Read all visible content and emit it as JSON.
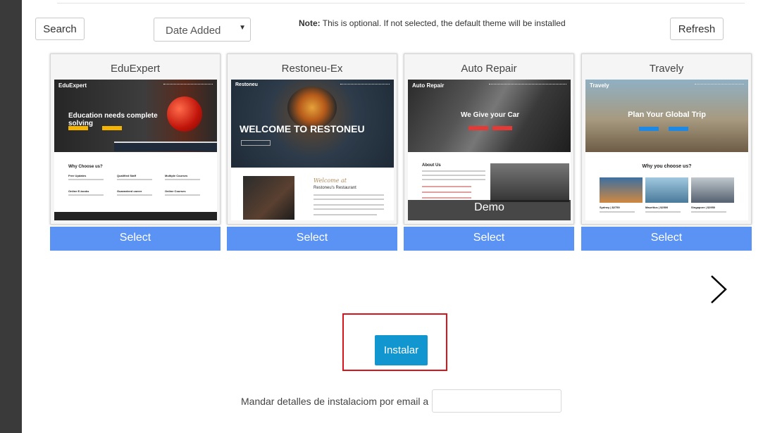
{
  "toolbar": {
    "search_label": "Search",
    "sort_value": "Date Added",
    "note_bold": "Note:",
    "note_text": " This is optional. If not selected, the default theme will be installed",
    "refresh_label": "Refresh"
  },
  "themes": [
    {
      "title": "EduExpert",
      "hero_brand": "EduExpert",
      "hero_heading": "Education needs complete solving",
      "section_heading": "Why Choose us?",
      "features": [
        "Free Updates",
        "Qualified Staff",
        "Multiple Courses",
        "Online E-books",
        "Guaranteed career",
        "Online Courses"
      ],
      "select_label": "Select"
    },
    {
      "title": "Restoneu-Ex",
      "hero_brand": "Restoneu",
      "hero_heading": "WELCOME TO RESTONEU",
      "section_heading": "Welcome at",
      "section_sub": "Restoneu's Restaurant",
      "select_label": "Select"
    },
    {
      "title": "Auto Repair",
      "hero_brand": "Auto Repair",
      "hero_heading": "We Give your Car",
      "section_heading": "About Us",
      "demo_label": "Demo",
      "select_label": "Select"
    },
    {
      "title": "Travely",
      "hero_brand": "Travely",
      "hero_heading": "Plan Your Global Trip",
      "section_heading": "Why you choose us?",
      "destinations": [
        "Sydney | $2750",
        "Mauritius | $2500",
        "Singapore | $2950"
      ],
      "select_label": "Select"
    }
  ],
  "install": {
    "button_label": "Instalar",
    "email_label": "Mandar detalles de instalaciom por email a :",
    "email_value": ""
  },
  "colors": {
    "select_bar": "#5b93f4",
    "install_button": "#1296cf",
    "highlight_border": "#d9141a"
  }
}
